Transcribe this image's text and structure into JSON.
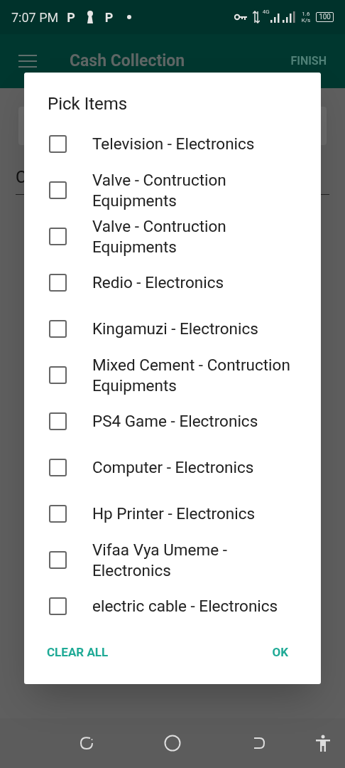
{
  "status_bar": {
    "time": "7:07 PM",
    "notification_letters": [
      "P",
      "P"
    ],
    "network": "4G",
    "speed_value": "1.6",
    "speed_unit": "K/s",
    "battery": "100"
  },
  "app_bar": {
    "title": "Cash Collection",
    "action": "FINISH"
  },
  "form": {
    "field_value": "C"
  },
  "dialog": {
    "title": "Pick Items",
    "items": [
      {
        "label": "Television - Electronics",
        "checked": false
      },
      {
        "label": "Valve - Contruction Equipments",
        "checked": false
      },
      {
        "label": "Valve - Contruction Equipments",
        "checked": false
      },
      {
        "label": "Redio - Electronics",
        "checked": false
      },
      {
        "label": "Kingamuzi - Electronics",
        "checked": false
      },
      {
        "label": "Mixed Cement - Contruction Equipments",
        "checked": false
      },
      {
        "label": "PS4 Game - Electronics",
        "checked": false
      },
      {
        "label": "Computer - Electronics",
        "checked": false
      },
      {
        "label": "Hp Printer - Electronics",
        "checked": false
      },
      {
        "label": "Vifaa Vya Umeme - Electronics",
        "checked": false
      },
      {
        "label": "electric cable - Electronics",
        "checked": false
      }
    ],
    "buttons": [
      {
        "label": "CLEAR ALL"
      },
      {
        "label": "OK"
      }
    ]
  }
}
